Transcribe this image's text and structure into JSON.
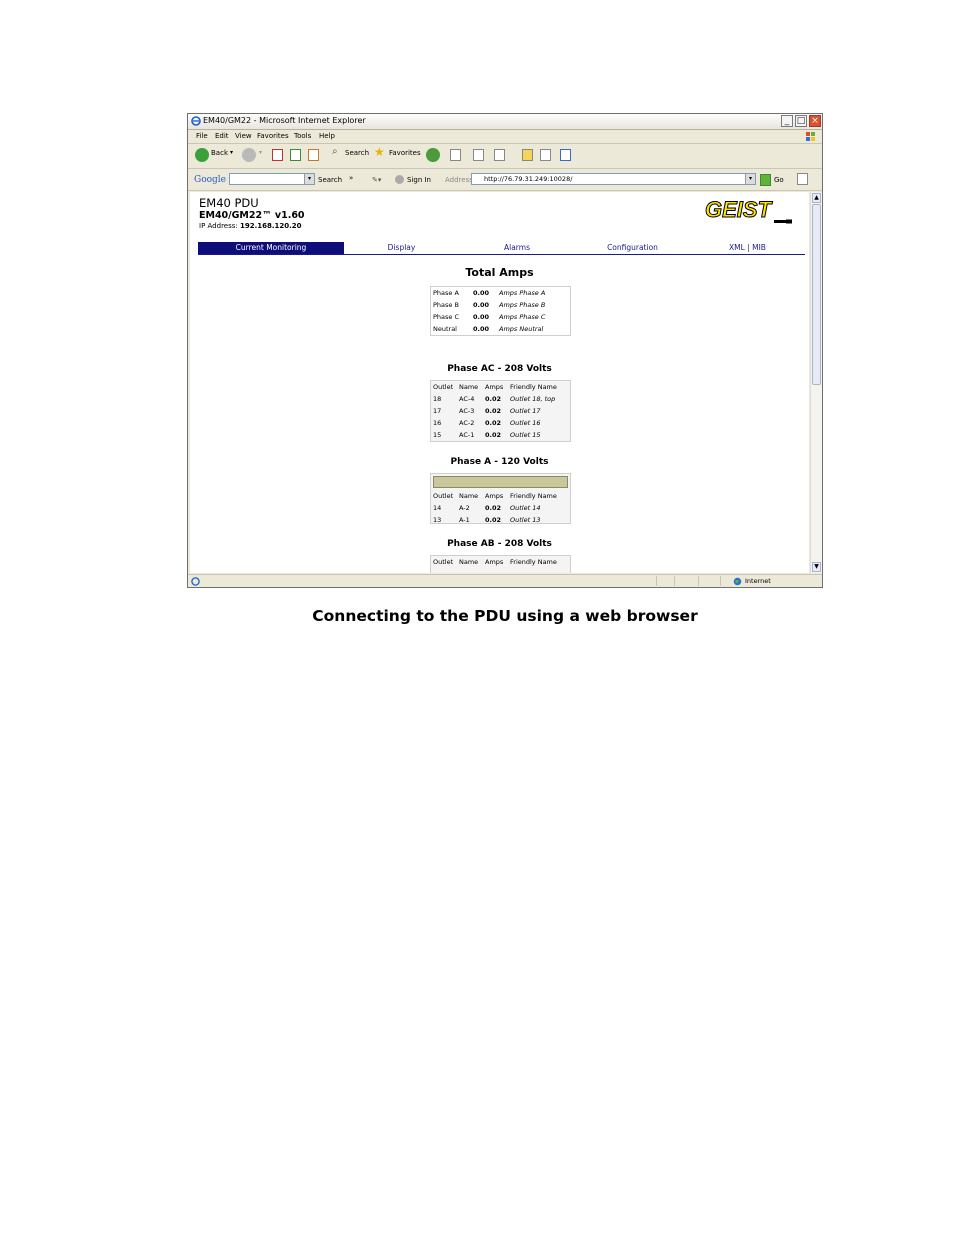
{
  "window": {
    "title": "EM40/GM22 - Microsoft Internet Explorer",
    "menu": [
      "File",
      "Edit",
      "View",
      "Favorites",
      "Tools",
      "Help"
    ],
    "toolbar": {
      "back": "Back",
      "search": "Search",
      "favorites": "Favorites"
    },
    "google": {
      "logo": "Google",
      "search_label": "Search",
      "chevrons": "»",
      "sign_in": "Sign In",
      "address_label": "Address",
      "url": "http://76.79.31.249:10028/",
      "go": "Go"
    },
    "status": {
      "zone": "Internet"
    }
  },
  "page": {
    "product": "EM40 PDU",
    "version": "EM40/GM22™ v1.60",
    "ip_label": "IP Address:",
    "ip": "192.168.120.20",
    "logo_text": "GEIST",
    "nav": [
      "Current Monitoring",
      "Display",
      "Alarms",
      "Configuration",
      "XML | MIB"
    ],
    "total_amps": {
      "title": "Total Amps",
      "rows": [
        {
          "label": "Phase A",
          "value": "0.00",
          "name": "Amps Phase A"
        },
        {
          "label": "Phase B",
          "value": "0.00",
          "name": "Amps Phase B"
        },
        {
          "label": "Phase C",
          "value": "0.00",
          "name": "Amps Phase C"
        },
        {
          "label": "Neutral",
          "value": "0.00",
          "name": "Amps Neutral"
        }
      ]
    },
    "columns": {
      "outlet": "Outlet",
      "name": "Name",
      "amps": "Amps",
      "friendly": "Friendly Name"
    },
    "phase_ac": {
      "title": "Phase AC - 208 Volts",
      "rows": [
        {
          "outlet": "18",
          "name": "AC-4",
          "amps": "0.02",
          "friendly": "Outlet 18, top"
        },
        {
          "outlet": "17",
          "name": "AC-3",
          "amps": "0.02",
          "friendly": "Outlet 17"
        },
        {
          "outlet": "16",
          "name": "AC-2",
          "amps": "0.02",
          "friendly": "Outlet 16"
        },
        {
          "outlet": "15",
          "name": "AC-1",
          "amps": "0.02",
          "friendly": "Outlet 15"
        }
      ]
    },
    "phase_a": {
      "title": "Phase A - 120 Volts",
      "rows": [
        {
          "outlet": "14",
          "name": "A-2",
          "amps": "0.02",
          "friendly": "Outlet 14"
        },
        {
          "outlet": "13",
          "name": "A-1",
          "amps": "0.02",
          "friendly": "Outlet 13"
        }
      ]
    },
    "phase_ab": {
      "title": "Phase AB - 208 Volts"
    }
  },
  "caption": "Connecting to the PDU using a web browser"
}
